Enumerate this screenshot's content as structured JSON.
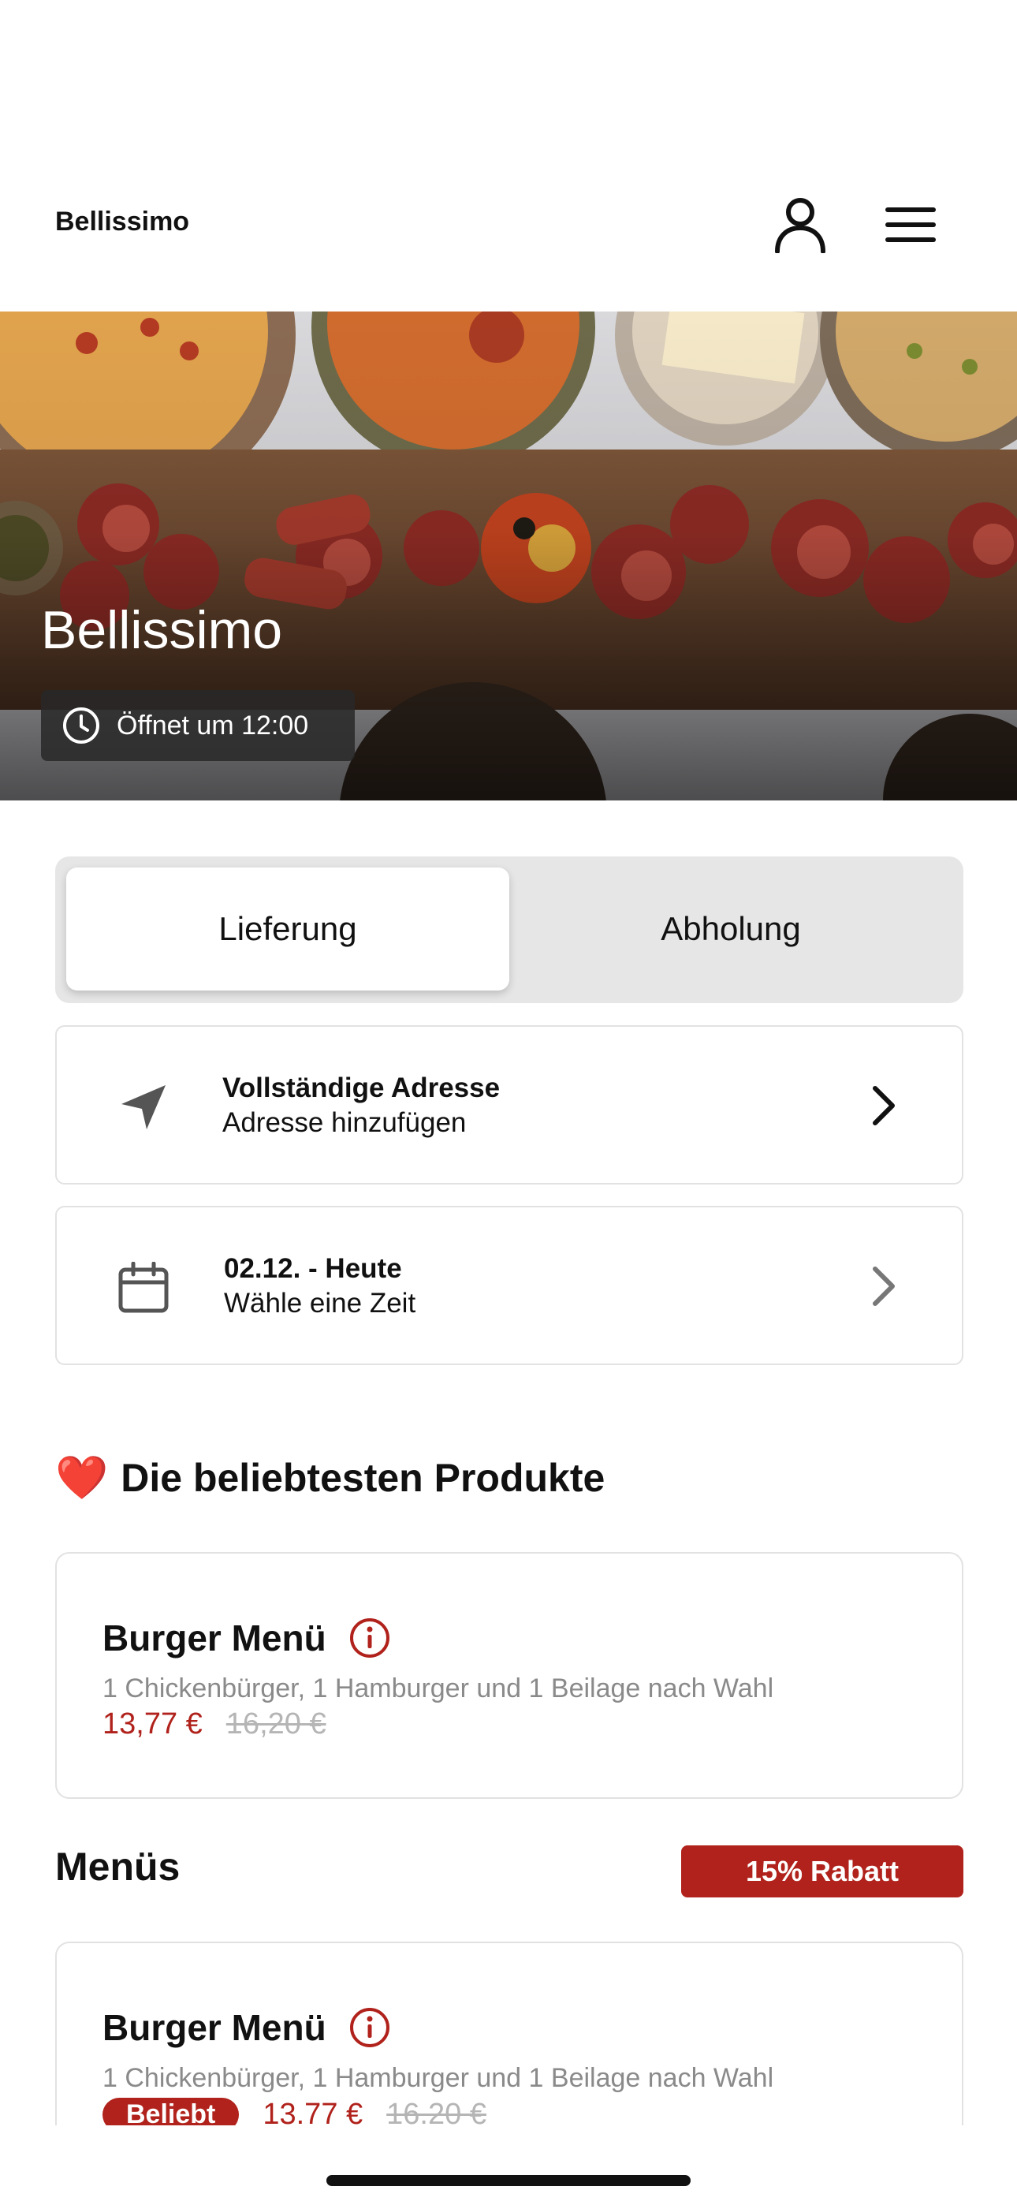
{
  "header": {
    "brand": "Bellissimo",
    "icons": {
      "account": "user-icon",
      "menu": "hamburger-menu-icon"
    }
  },
  "hero": {
    "title": "Bellissimo",
    "status": "Öffnet um 12:00",
    "status_icon": "clock-icon"
  },
  "order_mode": {
    "options": [
      "Lieferung",
      "Abholung"
    ],
    "selected": "Lieferung"
  },
  "address": {
    "title": "Vollständige Adresse",
    "subtitle": "Adresse hinzufügen",
    "icon": "location-arrow-icon"
  },
  "time": {
    "title": "02.12. - Heute",
    "subtitle": "Wähle eine Zeit",
    "icon": "calendar-icon"
  },
  "popular": {
    "emoji": "❤️",
    "heading": "Die beliebtesten Produkte",
    "product": {
      "name": "Burger Menü",
      "description": "1 Chickenbürger, 1 Hamburger und 1 Beilage nach Wahl",
      "price": "13,77 €",
      "old_price": "16,20 €"
    }
  },
  "menus": {
    "heading": "Menüs",
    "discount": "15% Rabatt",
    "product": {
      "name": "Burger Menü",
      "description": "1 Chickenbürger, 1 Hamburger und 1 Beilage nach Wahl",
      "badge": "Beliebt",
      "price": "13.77 €",
      "old_price": "16.20 €"
    }
  },
  "colors": {
    "accent": "#b0221b",
    "muted_text": "#8a8a8a",
    "segment_bg": "#e6e6e6"
  }
}
